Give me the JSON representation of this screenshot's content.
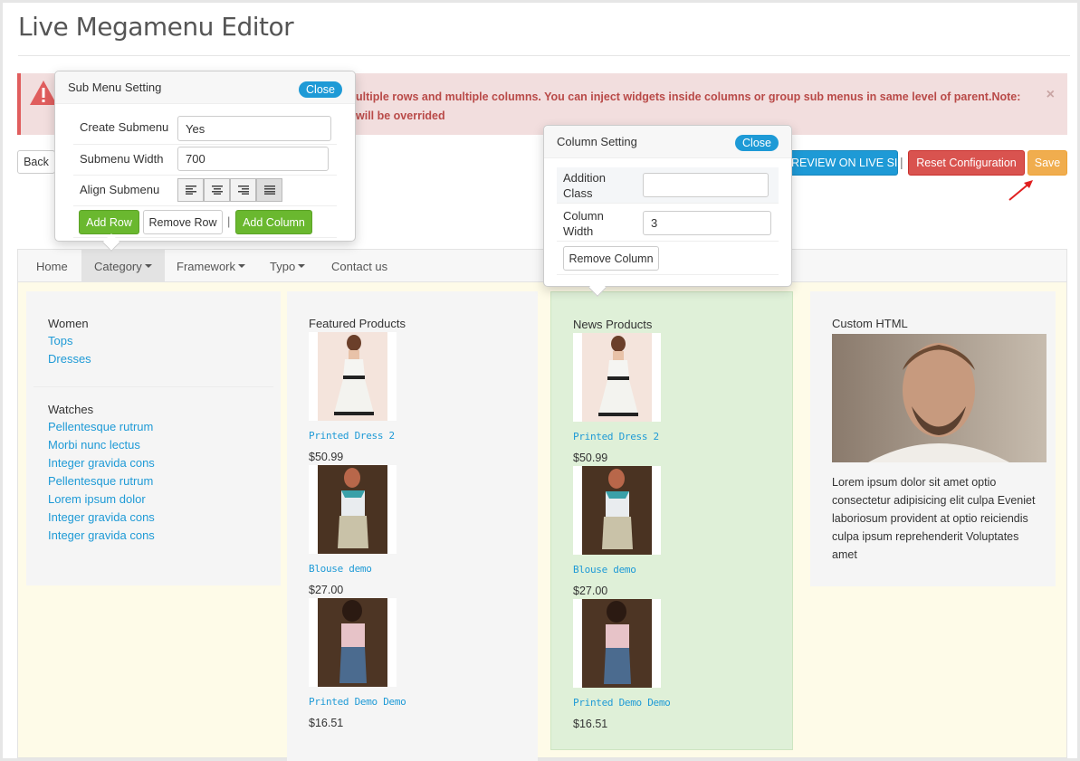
{
  "page": {
    "title": "Live Megamenu Editor"
  },
  "alert": {
    "text": "ultiple rows and multiple columns. You can inject widgets inside columns or group sub menus in same level of parent.Note:",
    "text2": "will be overrided",
    "close": "×"
  },
  "toolbar": {
    "back_label": "Back",
    "preview_label": "REVIEW ON LIVE SITE",
    "separator": "|",
    "reset_label": "Reset Configuration",
    "save_label": "Save"
  },
  "nav": {
    "items": [
      {
        "label": "Home"
      },
      {
        "label": "Category"
      },
      {
        "label": "Framework"
      },
      {
        "label": "Typo"
      },
      {
        "label": "Contact us"
      }
    ]
  },
  "submenu_setting": {
    "title": "Sub Menu Setting",
    "close_label": "Close",
    "create_label": "Create Submenu",
    "create_value": "Yes",
    "width_label": "Submenu Width",
    "width_value": "700",
    "align_label": "Align Submenu",
    "add_row": "Add Row",
    "remove_row": "Remove Row",
    "separator": "|",
    "add_column": "Add Column"
  },
  "column_setting": {
    "title": "Column Setting",
    "close_label": "Close",
    "class_label_1": "Addition",
    "class_label_2": "Class",
    "class_value": "",
    "width_label_1": "Column",
    "width_label_2": "Width",
    "width_value": "3",
    "remove_column": "Remove Column"
  },
  "columns": {
    "col1": {
      "group1_heading": "Women",
      "group1_links": [
        "Tops",
        "Dresses"
      ],
      "group2_heading": "Watches",
      "group2_links": [
        "Pellentesque rutrum",
        "Morbi nunc lectus",
        "Integer gravida cons",
        "Pellentesque rutrum",
        "Lorem ipsum dolor",
        "Integer gravida cons",
        "Integer gravida cons"
      ]
    },
    "col2": {
      "heading": "Featured Products",
      "products": [
        {
          "name": "Printed Dress 2",
          "price": "$50.99"
        },
        {
          "name": "Blouse demo",
          "price": "$27.00"
        },
        {
          "name": "Printed Demo Demo",
          "price": "$16.51"
        }
      ]
    },
    "col3": {
      "heading": "News Products",
      "products": [
        {
          "name": "Printed Dress 2",
          "price": "$50.99"
        },
        {
          "name": "Blouse demo",
          "price": "$27.00"
        },
        {
          "name": "Printed Demo Demo",
          "price": "$16.51"
        }
      ]
    },
    "col4": {
      "heading": "Custom HTML",
      "text": "Lorem ipsum dolor sit amet optio consectetur adipisicing elit culpa Eveniet laboriosum provident at optio reiciendis culpa ipsum reprehenderit Voluptates amet"
    }
  },
  "colors": {
    "accent": "#1e9ad6",
    "danger": "#d9534f",
    "warning": "#f0ad4e",
    "success": "#6ab82f",
    "alert_bg": "#f2dede",
    "column_highlight": "#dff0d8"
  }
}
